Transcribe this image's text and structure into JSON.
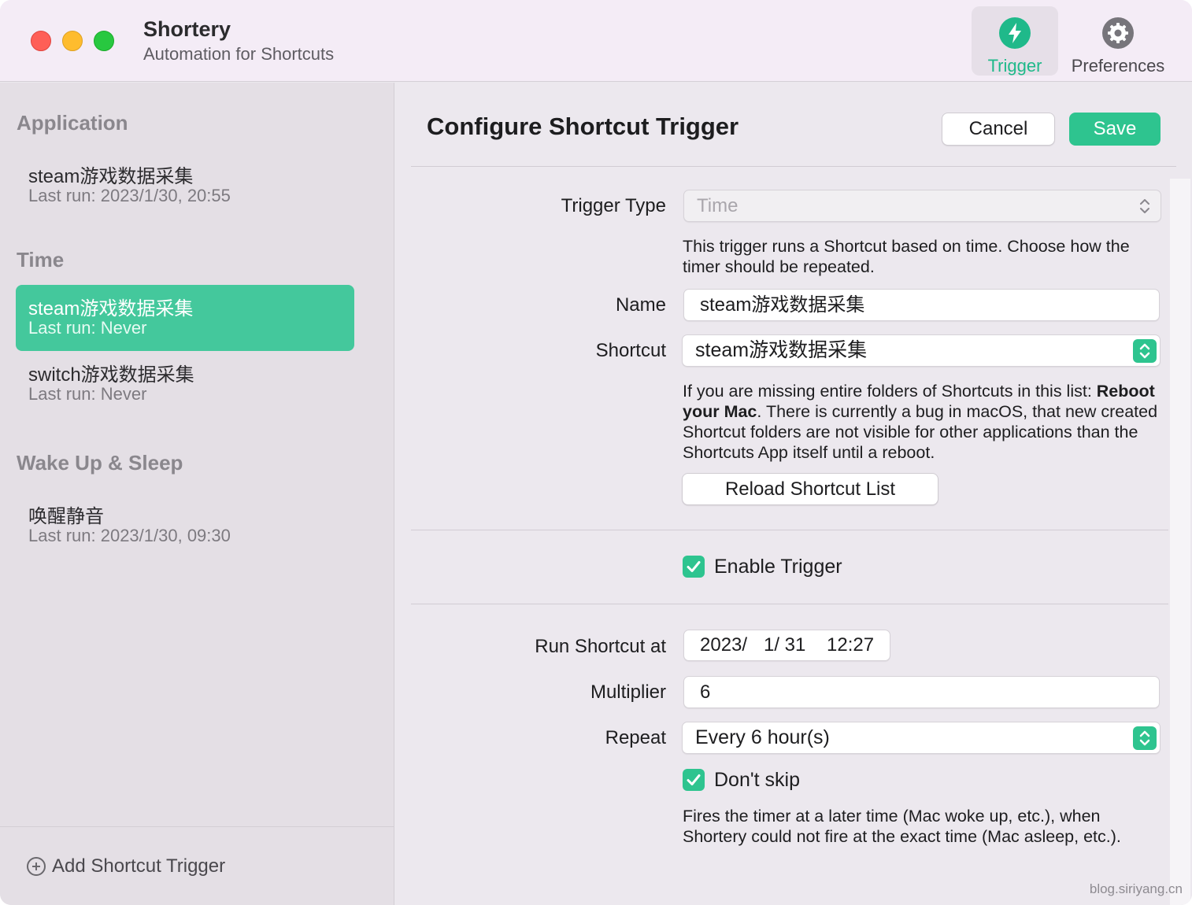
{
  "app": {
    "title": "Shortery",
    "subtitle": "Automation for Shortcuts"
  },
  "toolbar": {
    "trigger_label": "Trigger",
    "preferences_label": "Preferences",
    "trigger_icon": "bolt-icon",
    "preferences_icon": "gear-icon",
    "accent_color": "#1fb98a"
  },
  "sidebar": {
    "sections": [
      {
        "title": "Application",
        "items": [
          {
            "name": "steam游戏数据采集",
            "last_run": "Last run: 2023/1/30, 20:55"
          }
        ]
      },
      {
        "title": "Time",
        "items": [
          {
            "name": "steam游戏数据采集",
            "last_run": "Last run: Never",
            "selected": true
          },
          {
            "name": "switch游戏数据采集",
            "last_run": "Last run: Never"
          }
        ]
      },
      {
        "title": "Wake Up & Sleep",
        "items": [
          {
            "name": "唤醒静音",
            "last_run": "Last run: 2023/1/30, 09:30"
          }
        ]
      }
    ],
    "add_button": "Add Shortcut Trigger",
    "selected_color": "#44c89c"
  },
  "main": {
    "title": "Configure Shortcut Trigger",
    "cancel_label": "Cancel",
    "save_label": "Save",
    "trigger_type": {
      "label": "Trigger Type",
      "value": "Time",
      "help": "This trigger runs a Shortcut based on time. Choose how the timer should be repeated."
    },
    "name": {
      "label": "Name",
      "value": "steam游戏数据采集"
    },
    "shortcut": {
      "label": "Shortcut",
      "value": "steam游戏数据采集",
      "help_bold": "Reboot your Mac",
      "help_prefix": "If you are missing entire folders of Shortcuts in this list: ",
      "help_suffix": ". There is currently a bug in macOS, that new created Shortcut folders are not visible for other applications than the Shortcuts App itself until a reboot.",
      "reload_label": "Reload Shortcut List"
    },
    "enable_trigger": {
      "label": "Enable Trigger",
      "checked": true
    },
    "run_at": {
      "label": "Run Shortcut at",
      "year": "2023/",
      "month_day": "1/ 31",
      "time": "12:27"
    },
    "multiplier": {
      "label": "Multiplier",
      "value": "6"
    },
    "repeat": {
      "label": "Repeat",
      "value": "Every 6 hour(s)"
    },
    "dont_skip": {
      "label": "Don't skip",
      "checked": true,
      "help": "Fires the timer at a later time (Mac woke up, etc.), when Shortery could not fire at the exact time (Mac asleep, etc.)."
    }
  },
  "watermark": "blog.siriyang.cn"
}
